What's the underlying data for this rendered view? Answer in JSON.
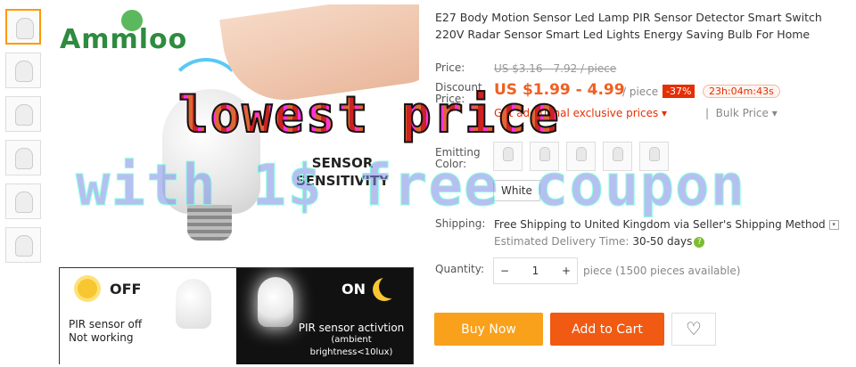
{
  "brand": "Ammloo",
  "thumbnails": [
    "thumb-1",
    "thumb-2",
    "thumb-3",
    "thumb-4",
    "thumb-5",
    "thumb-6"
  ],
  "main_image": {
    "sensor_text": [
      "SENSOR",
      "SENSITIVITY"
    ],
    "off_label": "OFF",
    "on_label": "ON",
    "pir_off_line1": "PIR sensor off",
    "pir_off_line2": "Not working",
    "pir_on_line1": "PIR sensor activtion",
    "pir_on_line2": "(ambient brightness<10lux)"
  },
  "overlay": {
    "line1": "lowest price",
    "line2": "with 1$ free coupon"
  },
  "product": {
    "title": "E27 Body Motion Sensor Led Lamp PIR Sensor Detector Smart Switch 220V Radar Sensor Smart Led Lights Energy Saving Bulb For Home"
  },
  "pricing": {
    "price_label": "Price:",
    "original_price": "US $3.16 - 7.92 / piece",
    "discount_label": "Discount Price:",
    "discount_price": "US $1.99 - 4.99",
    "per_piece": "/ piece",
    "discount_pct": "-37%",
    "timer": "23h:04m:43s",
    "exclusive_prices": "Get additional exclusive prices",
    "bulk_price": "Bulk Price"
  },
  "emitting_color": {
    "label": "Emitting Color:",
    "options": [
      "opt1",
      "opt2",
      "opt3",
      "opt4",
      "opt5"
    ],
    "selected": "White"
  },
  "shipping": {
    "label": "Shipping:",
    "text_bold": "Free Shipping",
    "text_rest": " to United Kingdom via Seller's Shipping Method",
    "estimated_label": "Estimated Delivery Time:",
    "estimated_value": "30-50 days"
  },
  "quantity": {
    "label": "Quantity:",
    "value": "1",
    "available": "piece (1500 pieces available)"
  },
  "actions": {
    "buy_now": "Buy Now",
    "add_to_cart": "Add to Cart"
  }
}
